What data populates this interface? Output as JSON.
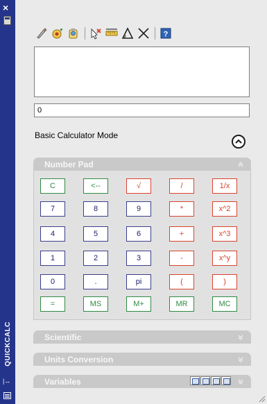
{
  "window": {
    "title": "QUICKCALC",
    "close_glyph": "×",
    "pin_glyph": "|↔"
  },
  "toolbar": {
    "buttons": [
      {
        "name": "clear-icon"
      },
      {
        "name": "clear-history-icon"
      },
      {
        "name": "paste-to-command-line-icon"
      },
      {
        "name": "get-coordinates-icon"
      },
      {
        "name": "distance-between-two-points-icon"
      },
      {
        "name": "angle-of-line-icon"
      },
      {
        "name": "intersection-of-four-points-icon"
      },
      {
        "name": "help-icon"
      }
    ]
  },
  "input": {
    "value": "0"
  },
  "mode": {
    "label": "Basic Calculator Mode"
  },
  "number_pad": {
    "title": "Number Pad",
    "keys": [
      [
        "C",
        "<--",
        "√",
        "/",
        "1/x"
      ],
      [
        "7",
        "8",
        "9",
        "*",
        "x^2"
      ],
      [
        "4",
        "5",
        "6",
        "+",
        "x^3"
      ],
      [
        "1",
        "2",
        "3",
        "-",
        "x^y"
      ],
      [
        "0",
        ".",
        "pi",
        "(",
        ")"
      ],
      [
        "=",
        "MS",
        "M+",
        "MR",
        "MC"
      ]
    ]
  },
  "sections": {
    "scientific": "Scientific",
    "units": "Units Conversion",
    "variables": "Variables"
  },
  "colors": {
    "strip": "#24348a",
    "key_green": "#2f8a43",
    "key_red": "#d9432e",
    "key_blue": "#3b3d8a",
    "section_bar": "#c9c9c9"
  }
}
